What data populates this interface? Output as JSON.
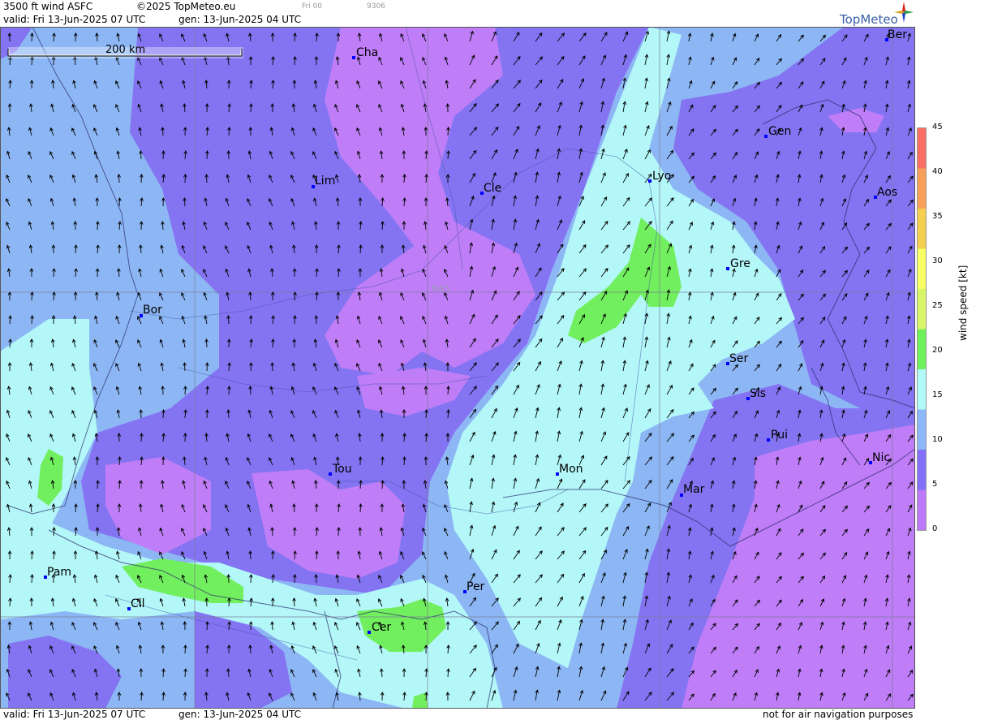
{
  "header": {
    "title": "3500 ft wind ASFC",
    "copyright": "©2025 TopMeteo.eu",
    "run": "Fri 00",
    "code": "9306",
    "valid": "valid:  Fri  13-Jun-2025  07 UTC",
    "generated": "gen: 13-Jun-2025 04 UTC",
    "brand": "TopMeteo"
  },
  "footer": {
    "valid": "valid:  Fri  13-Jun-2025  07 UTC",
    "generated": "gen: 13-Jun-2025 04 UTC",
    "disclaimer": "not for air navigation purposes"
  },
  "map": {
    "scale_label": "200 km",
    "grid_label": "N45",
    "cities": [
      {
        "label": "Cha",
        "dot": [
          436,
          38
        ],
        "text": [
          439,
          36
        ]
      },
      {
        "label": "Lim",
        "dot": [
          386,
          197
        ],
        "text": [
          388,
          194
        ]
      },
      {
        "label": "Cle",
        "dot": [
          594,
          205
        ],
        "text": [
          596,
          203
        ]
      },
      {
        "label": "Lyo",
        "dot": [
          801,
          190
        ],
        "text": [
          804,
          188
        ]
      },
      {
        "label": "Gen",
        "dot": [
          944,
          135
        ],
        "text": [
          947,
          133
        ]
      },
      {
        "label": "Ber",
        "dot": [
          1093,
          16
        ],
        "text": [
          1094,
          14
        ]
      },
      {
        "label": "Aos",
        "dot": [
          1079,
          210
        ],
        "text": [
          1081,
          208
        ]
      },
      {
        "label": "Gre",
        "dot": [
          897,
          298
        ],
        "text": [
          900,
          296
        ]
      },
      {
        "label": "Bor",
        "dot": [
          174,
          356
        ],
        "text": [
          176,
          353
        ]
      },
      {
        "label": "Ser",
        "dot": [
          897,
          415
        ],
        "text": [
          899,
          413
        ]
      },
      {
        "label": "Sis",
        "dot": [
          922,
          458
        ],
        "text": [
          924,
          456
        ]
      },
      {
        "label": "Pui",
        "dot": [
          947,
          509
        ],
        "text": [
          950,
          507
        ]
      },
      {
        "label": "Nic",
        "dot": [
          1073,
          537
        ],
        "text": [
          1075,
          535
        ]
      },
      {
        "label": "Tou",
        "dot": [
          407,
          551
        ],
        "text": [
          410,
          549
        ]
      },
      {
        "label": "Mon",
        "dot": [
          687,
          551
        ],
        "text": [
          689,
          549
        ]
      },
      {
        "label": "Mar",
        "dot": [
          840,
          577
        ],
        "text": [
          842,
          574
        ]
      },
      {
        "label": "Pam",
        "dot": [
          56,
          678
        ],
        "text": [
          58,
          676
        ]
      },
      {
        "label": "Cil",
        "dot": [
          159,
          717
        ],
        "text": [
          161,
          715
        ]
      },
      {
        "label": "Per",
        "dot": [
          573,
          696
        ],
        "text": [
          575,
          694
        ]
      },
      {
        "label": "Cer",
        "dot": [
          455,
          746
        ],
        "text": [
          458,
          744
        ]
      }
    ]
  },
  "legend": {
    "title": "wind speed [kt]",
    "ticks": [
      "45",
      "40",
      "35",
      "30",
      "25",
      "20",
      "15",
      "10",
      "5",
      "0"
    ],
    "colors": [
      "#fa6e64",
      "#f8a05a",
      "#f5d050",
      "#f8ff64",
      "#d8f568",
      "#6ef05a",
      "#b0fafa",
      "#8cb8fa",
      "#8270fa",
      "#bd78fa"
    ]
  },
  "colors": {
    "calm": "#bf7ef7",
    "light": "#8474f2",
    "moderate": "#8db7f4",
    "fresh": "#b3f7f8",
    "strong": "#72ef5e"
  }
}
